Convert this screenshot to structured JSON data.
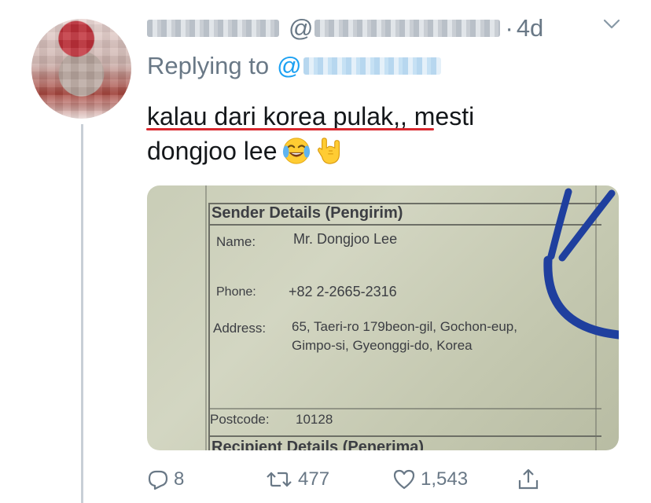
{
  "tweet": {
    "handle_prefix": "@",
    "dot": "·",
    "time": "4d",
    "replying_label": "Replying to",
    "replying_at": "@",
    "text_line1": "kalau dari korea pulak,, mesti",
    "text_line2": "dongjoo lee"
  },
  "photo": {
    "section_title": "Sender Details (Pengirim)",
    "name_label": "Name:",
    "name_value": "Mr. Dongjoo Lee",
    "phone_label": "Phone:",
    "phone_value": "+82 2-2665-2316",
    "address_label": "Address:",
    "address_line1": "65, Taeri-ro 179beon-gil, Gochon-eup,",
    "address_line2": "Gimpo-si, Gyeonggi-do, Korea",
    "postcode_label": "Postcode:",
    "postcode_value": "10128",
    "next_section": "Recipient Details (Penerima)"
  },
  "actions": {
    "replies": "8",
    "retweets": "477",
    "likes": "1,543"
  },
  "colors": {
    "text": "#14171a",
    "meta": "#697886",
    "link": "#1da1f2",
    "underline": "#d9282f"
  }
}
